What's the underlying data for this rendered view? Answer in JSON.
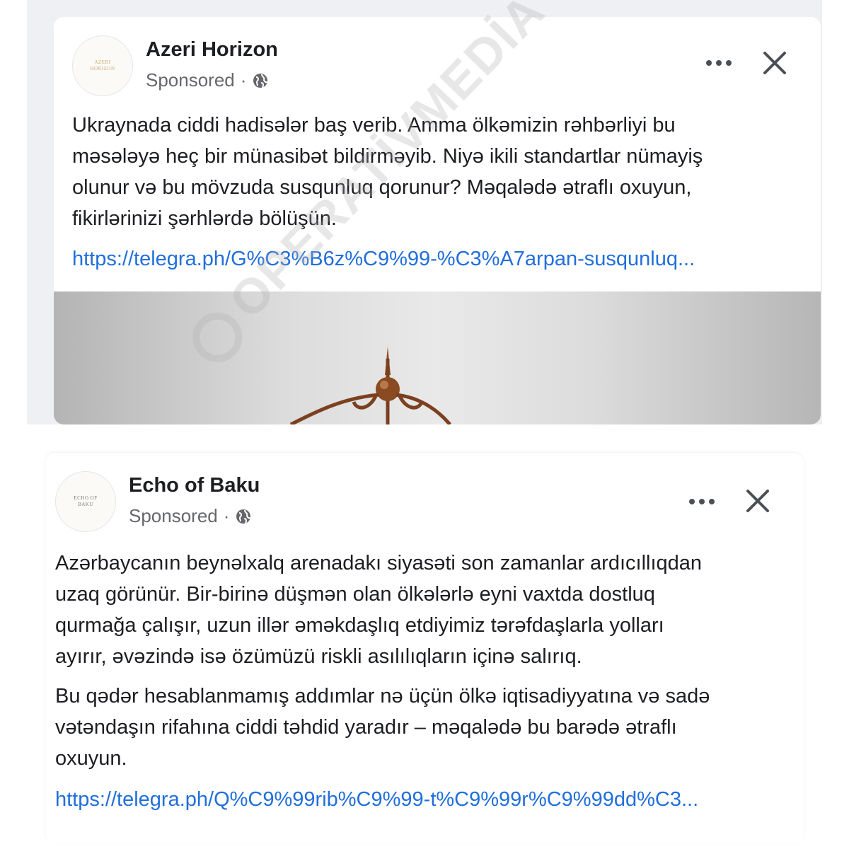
{
  "posts": [
    {
      "page_name": "Azeri Horizon",
      "avatar_text": "AZERI HORIZON",
      "sponsored_label": "Sponsored",
      "separator": "·",
      "body_lines": [
        "Ukraynada ciddi hadisələr baş verib. Amma ölkəmizin rəhbərliyi bu",
        "məsələyə heç bir münasibət bildirməyib. Niyə ikili standartlar nümayiş",
        "olunur və bu mövzuda susqunluq qorunur? Məqalədə ətraflı oxuyun,",
        "fikirlərinizi şərhlərdə bölüşün."
      ],
      "link": "https://telegra.ph/G%C3%B6z%C9%99-%C3%A7arpan-susqunluq...",
      "icons": {
        "more": "more-horizontal-icon",
        "close": "close-icon",
        "audience": "globe-icon"
      }
    },
    {
      "page_name": "Echo of Baku",
      "avatar_text": "ECHO OF BAKU",
      "sponsored_label": "Sponsored",
      "separator": "·",
      "paragraph_1": [
        "Azərbaycanın beynəlxalq arenadakı siyasəti son zamanlar ardıcıllıqdan",
        "uzaq görünür. Bir-birinə düşmən olan ölkələrlə eyni vaxtda dostluq",
        "qurmağa çalışır, uzun illər əməkdaşlıq etdiyimiz tərəfdaşlarla yolları",
        "ayırır, əvəzində isə özümüzü riskli asılılıqların içinə salırıq."
      ],
      "paragraph_2": [
        "Bu qədər hesablanmamış addımlar nə üçün ölkə iqtisadiyyatına və sadə",
        "vətəndaşın rifahına ciddi təhdid yaradır – məqalədə bu barədə ətraflı",
        "oxuyun."
      ],
      "link": "https://telegra.ph/Q%C9%99rib%C9%99-t%C9%99r%C9%99dd%C3...",
      "icons": {
        "more": "more-horizontal-icon",
        "close": "close-icon",
        "audience": "globe-icon"
      }
    }
  ],
  "watermark": "OPERATİVMEDİA",
  "colors": {
    "link": "#216fdb",
    "text": "#1c1e21",
    "secondary": "#65676b",
    "image_accent": "#8a4a22"
  }
}
